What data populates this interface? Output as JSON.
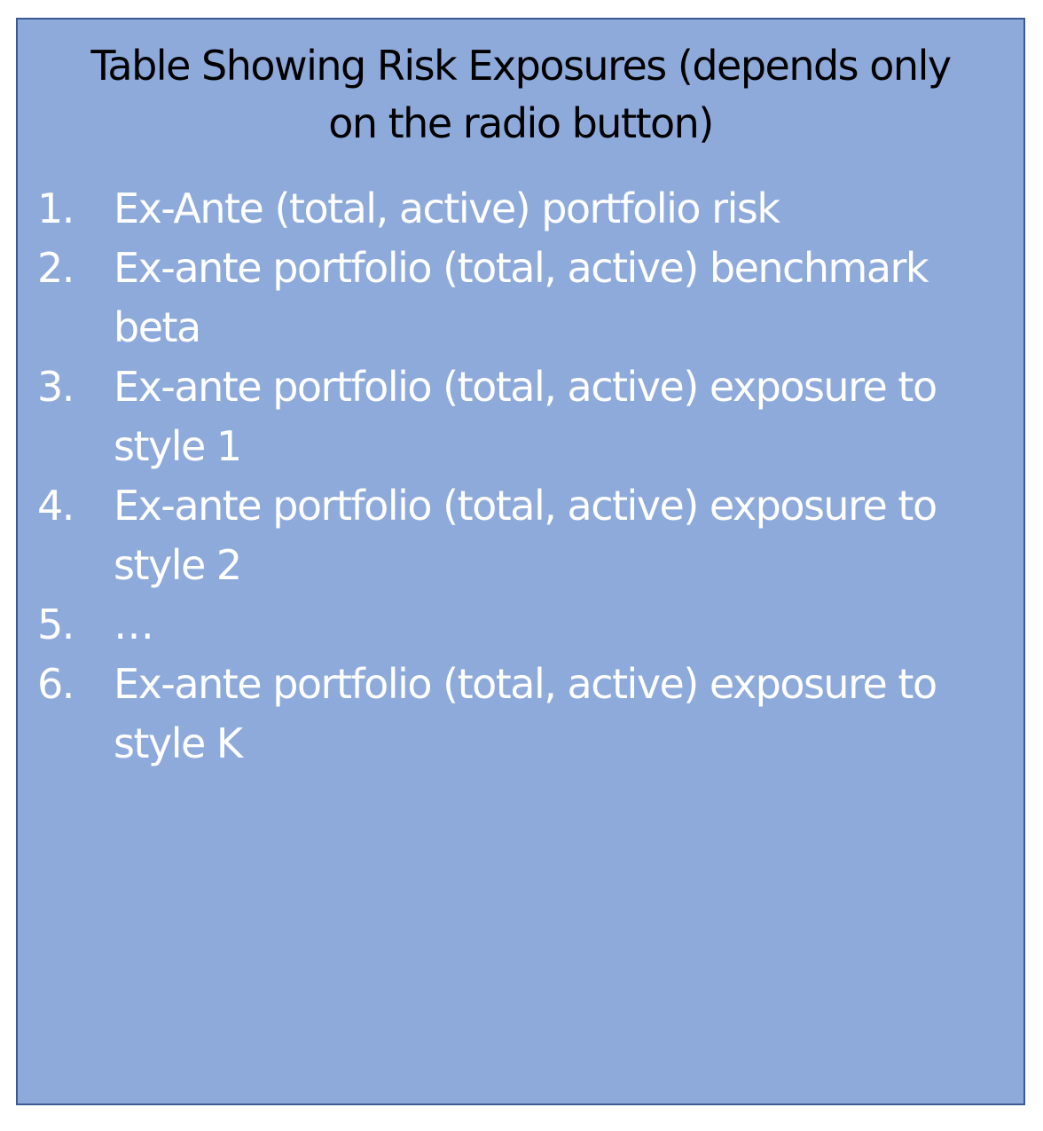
{
  "colors": {
    "panel_background": "#8eaadb",
    "panel_border": "#3b5994",
    "title_text": "#000000",
    "list_text": "#ffffff"
  },
  "title_line_1": "Table Showing Risk Exposures (depends only",
  "title_line_2": "on the radio button)",
  "items": [
    {
      "number": "1.",
      "text": "Ex-Ante (total, active) portfolio risk"
    },
    {
      "number": "2.",
      "text": "Ex-ante portfolio (total, active) benchmark beta"
    },
    {
      "number": "3.",
      "text": "Ex-ante portfolio (total, active) exposure to style 1"
    },
    {
      "number": "4.",
      "text": "Ex-ante portfolio (total, active) exposure to style 2"
    },
    {
      "number": "5.",
      "text": "…"
    },
    {
      "number": "6.",
      "text": "Ex-ante portfolio (total, active) exposure to style K"
    }
  ]
}
